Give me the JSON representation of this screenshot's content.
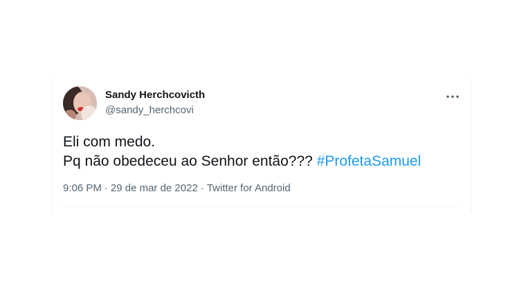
{
  "tweet": {
    "author": {
      "display_name": "Sandy Herchcovicth",
      "handle": "@sandy_herchcovi",
      "avatar_icon": "profile-photo"
    },
    "more_icon": "more-horizontal-icon",
    "text_line1": "Eli com medo.",
    "text_line2_prefix": "Pq não obedeceu ao Senhor então???",
    "hashtag": "#ProfetaSamuel",
    "time": "9:06 PM",
    "separator": "·",
    "date": "29 de mar de 2022",
    "source": "Twitter for Android",
    "colors": {
      "text": "#0f1419",
      "secondary": "#536471",
      "link": "#1d9bf0",
      "border": "#eff3f4"
    }
  }
}
